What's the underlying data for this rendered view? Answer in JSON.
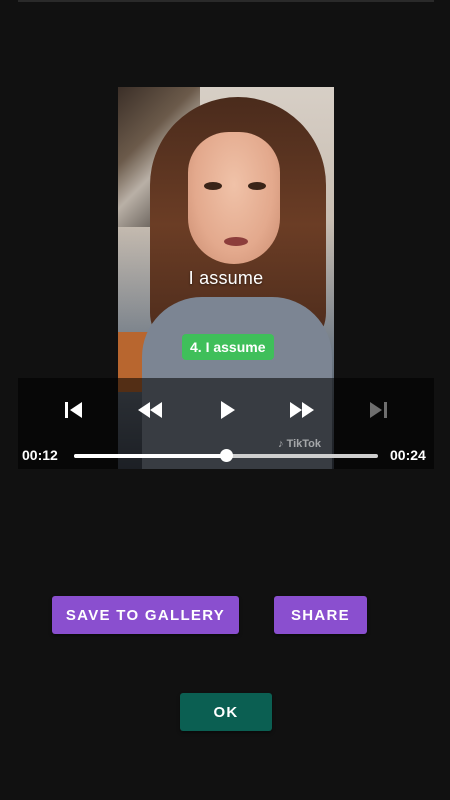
{
  "video": {
    "subtitle": "I assume",
    "badge": "4. I assume",
    "watermark": "TikTok"
  },
  "player": {
    "current_time": "00:12",
    "total_time": "00:24",
    "progress": 0.5,
    "controls": {
      "prev_icon": "skip-previous-icon",
      "rewind_icon": "rewind-icon",
      "play_icon": "play-icon",
      "forward_icon": "fast-forward-icon",
      "next_icon": "skip-next-icon"
    }
  },
  "actions": {
    "save_label": "SAVE TO GALLERY",
    "share_label": "SHARE",
    "ok_label": "OK"
  },
  "colors": {
    "background": "#111111",
    "primary_button": "#8a4fcf",
    "ok_button": "#0b5f52",
    "badge": "#3fbf5a"
  }
}
